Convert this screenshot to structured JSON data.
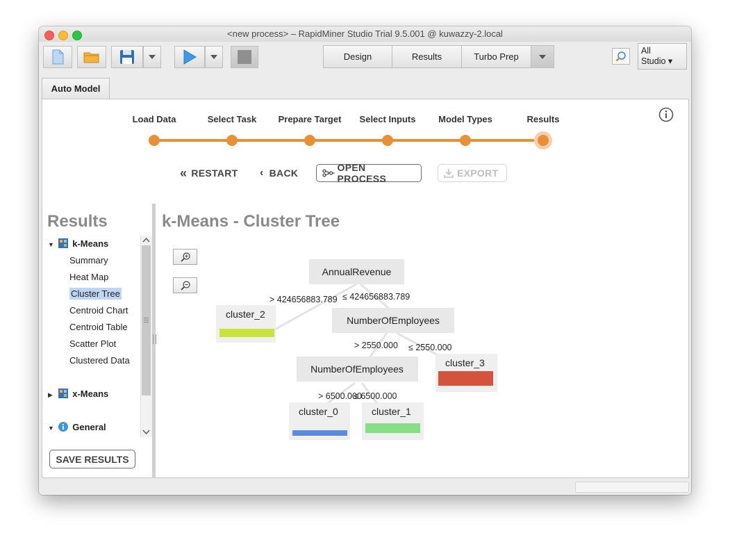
{
  "window": {
    "title": "<new process> – RapidMiner Studio Trial 9.5.001 @ kuwazzy-2.local"
  },
  "toolbar": {
    "perspectives": [
      "Design",
      "Results",
      "Turbo Prep"
    ],
    "studio_line1": "All",
    "studio_line2": "Studio ▾"
  },
  "tabs": {
    "active": "Auto Model"
  },
  "steps": {
    "labels": [
      "Load Data",
      "Select Task",
      "Prepare Target",
      "Select Inputs",
      "Model Types",
      "Results"
    ],
    "current": "Results"
  },
  "nav": {
    "restart": "RESTART",
    "back": "BACK",
    "open_process": "OPEN PROCESS",
    "export": "EXPORT"
  },
  "sidebar": {
    "heading": "Results",
    "kmeans": "k-Means",
    "kmeans_items": [
      "Summary",
      "Heat Map",
      "Cluster Tree",
      "Centroid Chart",
      "Centroid Table",
      "Scatter Plot",
      "Clustered Data"
    ],
    "selected": "Cluster Tree",
    "xmeans": "x-Means",
    "general": "General",
    "save": "SAVE RESULTS"
  },
  "main": {
    "title": "k-Means - Cluster Tree"
  },
  "tree": {
    "nodes": {
      "annual_revenue": "AnnualRevenue",
      "employees_1": "NumberOfEmployees",
      "employees_2": "NumberOfEmployees",
      "cluster_2": "cluster_2",
      "cluster_3": "cluster_3",
      "cluster_0": "cluster_0",
      "cluster_1": "cluster_1"
    },
    "edges": {
      "rev_gt": "> 424656883.789",
      "rev_le": "≤ 424656883.789",
      "emp1_gt": "> 2550.000",
      "emp1_le": "≤ 2550.000",
      "emp2_gt": "> 6500.000",
      "emp2_le": "≤ 6500.000"
    },
    "colors": {
      "cluster_2": "#c9e23c",
      "cluster_3": "#d5533d",
      "cluster_0": "#5b8be0",
      "cluster_1": "#86df86"
    }
  }
}
